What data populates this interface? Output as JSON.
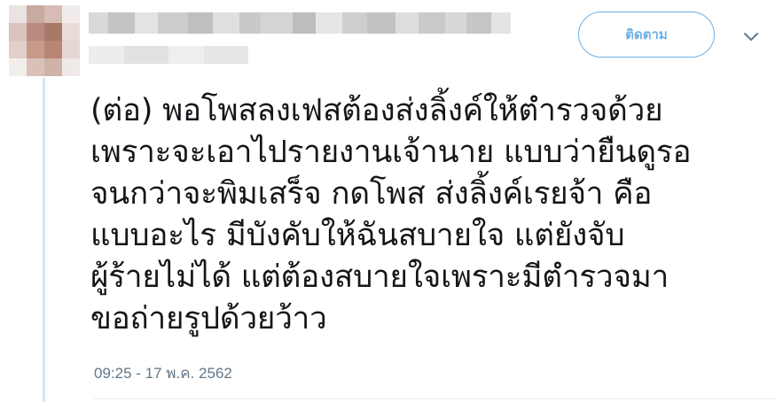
{
  "tweet": {
    "follow_label": "ติดตาม",
    "text_lines": [
      "(ต่อ) พอโพสลงเฟสต้องส่งลิ้งค์ให้ตำรวจด้วย",
      "เพราะจะเอาไปรายงานเจ้านาย แบบว่ายืนดูรอ",
      "จนกว่าจะพิมเสร็จ กดโพส ส่งลิ้งค์เรยจ้า คือ",
      "แบบอะไร มีบังคับให้ฉันสบายใจ แต่ยังจับ",
      "ผู้ร้ายไม่ได้ แต่ต้องสบายใจเพราะมีตำรวจมา",
      "ขอถ่ายรูปด้วยว้าว"
    ],
    "timestamp": "09:25 - 17 พ.ค. 2562"
  },
  "icons": {
    "menu": "chevron-down-icon"
  },
  "colors": {
    "accent": "#6cb1e6",
    "text": "#14171a",
    "muted": "#657786",
    "thread_line": "#cfe7f8"
  }
}
